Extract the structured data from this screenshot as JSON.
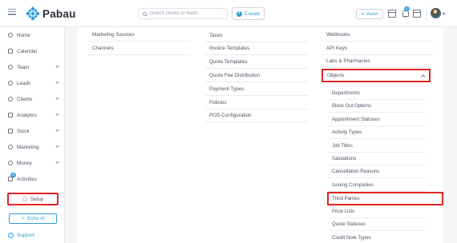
{
  "app": {
    "brand": "Pabau",
    "accent": "#2f9ed8",
    "highlight": "#e02424"
  },
  "topbar": {
    "search_placeholder": "Search clients or leads",
    "create_label": "Create",
    "vision_label": "Vision",
    "notification_count": "12",
    "icons": [
      "menu-icon",
      "search-icon",
      "plus-icon",
      "calendar-icon",
      "bell-icon",
      "window-icon",
      "avatar"
    ]
  },
  "sidebar": {
    "items": [
      {
        "label": "Home",
        "icon": "home-icon"
      },
      {
        "label": "Calendar",
        "icon": "calendar-icon"
      },
      {
        "label": "Team",
        "icon": "team-icon"
      },
      {
        "label": "Leads",
        "icon": "leads-icon"
      },
      {
        "label": "Clients",
        "icon": "clients-icon"
      },
      {
        "label": "Analytics",
        "icon": "analytics-icon"
      },
      {
        "label": "Stock",
        "icon": "stock-icon"
      },
      {
        "label": "Marketing",
        "icon": "marketing-icon"
      },
      {
        "label": "Money",
        "icon": "money-icon"
      },
      {
        "label": "Activities",
        "icon": "activities-icon"
      }
    ],
    "activities_badge": "16",
    "setup_label": "Setup",
    "echo_label": "Echo AI",
    "support_label": "Support"
  },
  "columns": {
    "col1": [
      "Marketing Sources",
      "Channels"
    ],
    "col2": [
      "Taxes",
      "Invoice Templates",
      "Quote Templates",
      "Quote Fee Distribution",
      "Payment Types",
      "Policies",
      "POS Configuration"
    ],
    "col3": [
      "Webhooks",
      "API Keys",
      "Labs & Pharmacies"
    ],
    "objects_label": "Objects",
    "objects_children": [
      "Departments",
      "Block Out Options",
      "Appointment Statuses",
      "Activity Types",
      "Job Titles",
      "Salutations",
      "Cancellation Reasons",
      "Issuing Companies",
      "Third Parties",
      "Price Lists",
      "Quote Statuses",
      "Credit Note Types"
    ]
  }
}
